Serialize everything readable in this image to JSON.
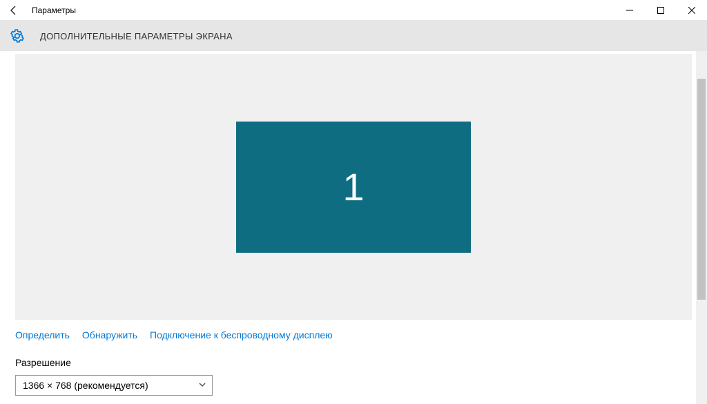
{
  "window": {
    "title": "Параметры"
  },
  "header": {
    "title": "ДОПОЛНИТЕЛЬНЫЕ ПАРАМЕТРЫ ЭКРАНА"
  },
  "display": {
    "monitor_number": "1"
  },
  "links": {
    "identify": "Определить",
    "detect": "Обнаружить",
    "wireless": "Подключение к беспроводному дисплею"
  },
  "resolution": {
    "label": "Разрешение",
    "selected": "1366 × 768 (рекомендуется)"
  },
  "colors": {
    "monitor_bg": "#0f6d82",
    "link": "#0078d7"
  }
}
